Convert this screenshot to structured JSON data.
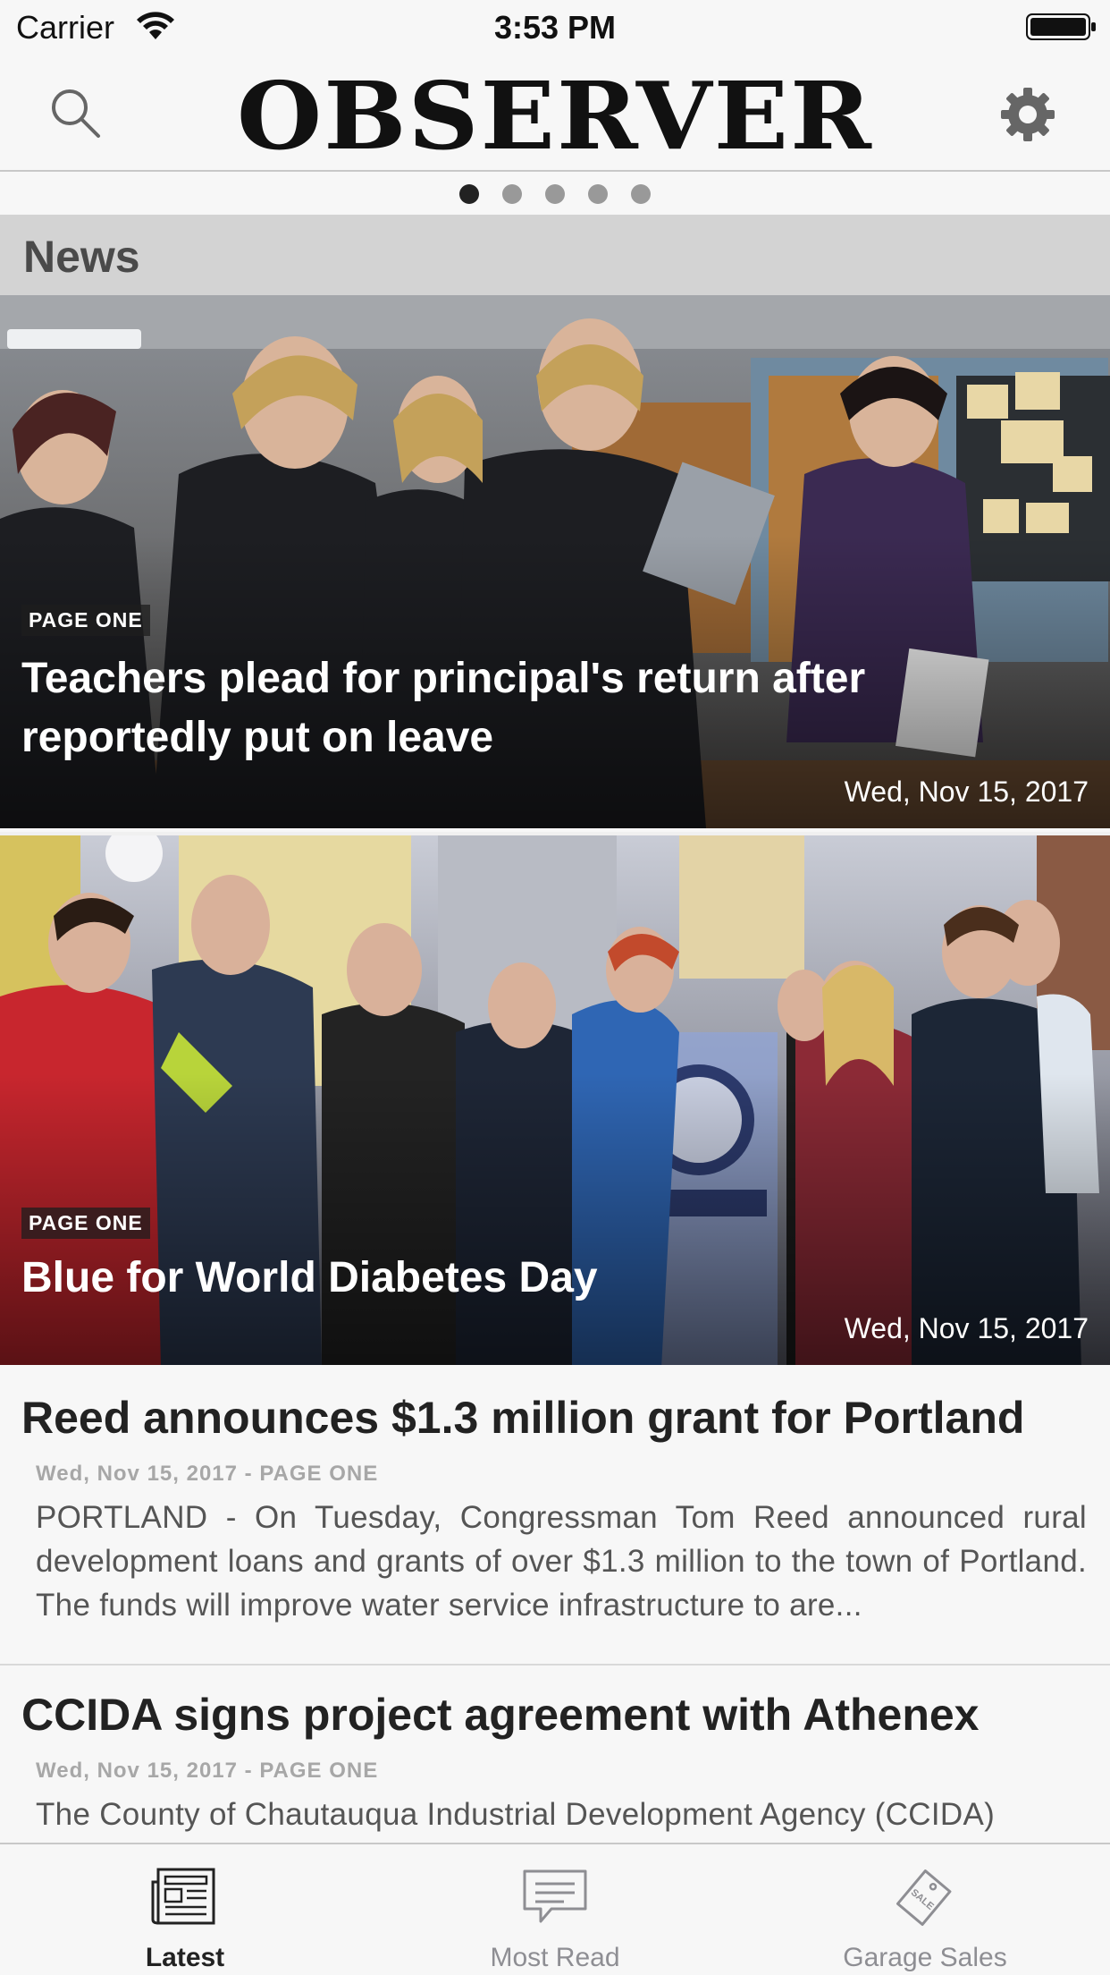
{
  "status_bar": {
    "carrier": "Carrier",
    "time": "3:53 PM",
    "wifi_icon": "wifi-icon",
    "battery_icon": "battery-icon"
  },
  "nav": {
    "brand": "OBSERVER",
    "search_icon": "search-icon",
    "settings_icon": "gear-icon"
  },
  "pager": {
    "count": 5,
    "active_index": 0
  },
  "section": {
    "title": "News"
  },
  "features": [
    {
      "badge": "PAGE ONE",
      "title": "Teachers plead for principal's return after reportedly put on leave",
      "date": "Wed, Nov 15, 2017"
    },
    {
      "badge": "PAGE ONE",
      "title": "Blue for World Diabetes Day",
      "date": "Wed, Nov 15, 2017"
    }
  ],
  "articles": [
    {
      "title": "Reed announces $1.3 million grant for Portland",
      "meta": "Wed, Nov 15, 2017 - PAGE ONE",
      "summary": "PORTLAND - On Tuesday, Congressman Tom Reed announced rural development loans and grants of over $1.3 million to the town of Portland. The funds will improve water service infrastructure to are..."
    },
    {
      "title": "CCIDA signs project agreement with Athenex",
      "meta": "Wed, Nov 15, 2017 - PAGE ONE",
      "summary": "The County of Chautauqua Industrial Development Agency (CCIDA)"
    }
  ],
  "tabs": [
    {
      "label": "Latest",
      "icon": "newspaper-icon",
      "active": true
    },
    {
      "label": "Most Read",
      "icon": "comment-icon",
      "active": false
    },
    {
      "label": "Garage Sales",
      "icon": "sale-tag-icon",
      "active": false
    }
  ],
  "colors": {
    "background": "#f7f7f7",
    "section_header": "#d3d3d3",
    "active_tab": "#222222",
    "inactive_tab": "#8e8e93"
  }
}
